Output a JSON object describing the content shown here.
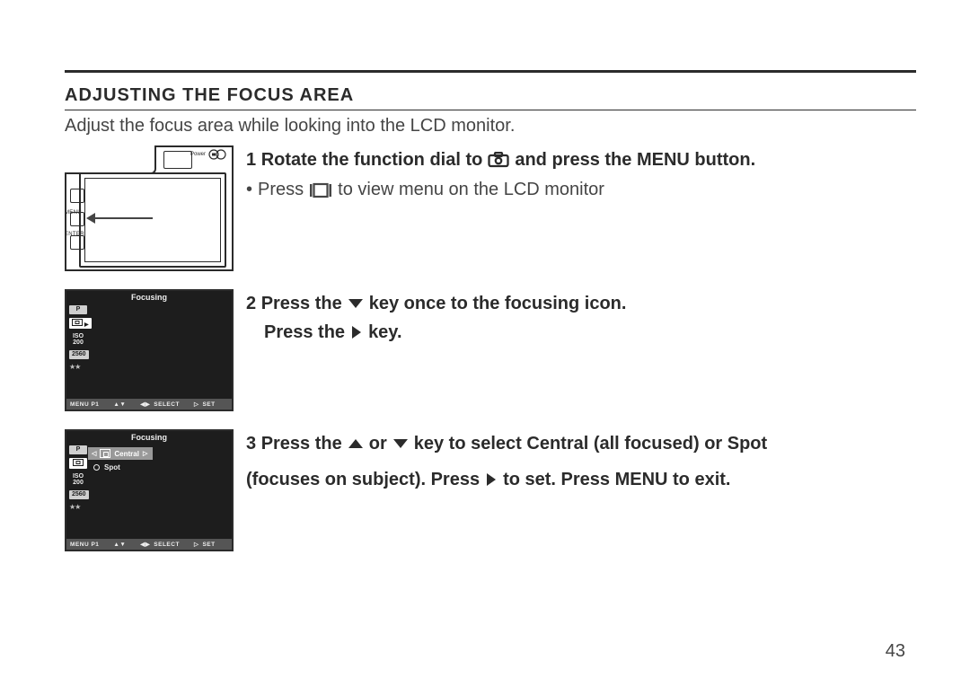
{
  "heading": "ADJUSTING THE FOCUS AREA",
  "intro": "Adjust the focus area  while looking into the LCD monitor.",
  "step1": {
    "num": "1",
    "a": "Rotate the function dial to",
    "b": "and press the MENU button.",
    "sub_a": "Press",
    "sub_b": "to view menu on the LCD monitor"
  },
  "camera_labels": {
    "menu": "MENU",
    "enter": "ENTER",
    "power": "Power"
  },
  "step2": {
    "num": "2",
    "a": "Press the",
    "b": "key once to the focusing icon.",
    "c": "Press the",
    "d": "key."
  },
  "step3": {
    "num": "3",
    "a": "Press the",
    "b": "or",
    "c": "key to select Central (all focused) or Spot",
    "d": "(focuses on subject). Press",
    "e": "to set.  Press MENU to exit."
  },
  "lcd": {
    "title": "Focusing",
    "p": "P",
    "iso": "ISO\n200",
    "res": "2560",
    "menu_p1": "MENU P1",
    "select": "SELECT",
    "set": "SET",
    "central": "Central",
    "spot": "Spot"
  },
  "page_number": "43"
}
